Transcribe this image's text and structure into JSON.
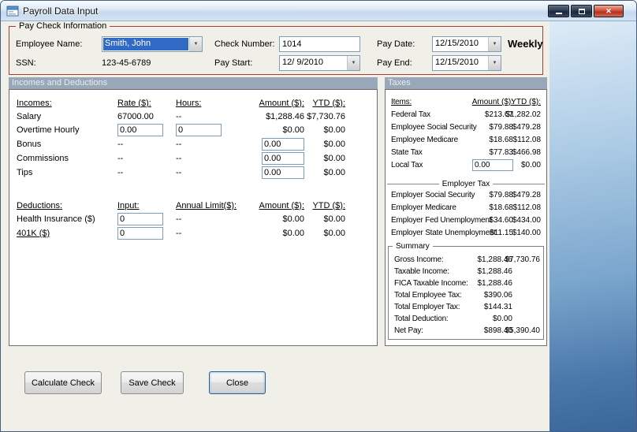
{
  "window": {
    "title": "Payroll Data Input"
  },
  "icons": {
    "dropdown_arrow": "▼",
    "close_glyph": "✕"
  },
  "colors": {
    "group_border": "#A33E35",
    "section_header_bg": "#98A8B8",
    "selection_blue": "#316AC5",
    "desktop_gradient_bottom": "#3A679B"
  },
  "pay_check_information": {
    "title": "Pay Check Information",
    "employee_name": {
      "label": "Employee Name:",
      "value": "Smith, John"
    },
    "ssn": {
      "label": "SSN:",
      "value": "123-45-6789"
    },
    "check_number": {
      "label": "Check Number:",
      "value": "1014"
    },
    "pay_start": {
      "label": "Pay Start:",
      "value": "12/ 9/2010"
    },
    "pay_date": {
      "label": "Pay Date:",
      "value": "12/15/2010"
    },
    "pay_end": {
      "label": "Pay End:",
      "value": "12/15/2010"
    },
    "frequency": "Weekly"
  },
  "incomes_and_deductions": {
    "header": "Incomes and Deductions",
    "income_headers": {
      "item": "Incomes:",
      "rate": "Rate ($):",
      "hours": "Hours:",
      "amount": "Amount ($):",
      "ytd": "YTD ($):"
    },
    "income_rows": [
      {
        "label": "Salary",
        "rate": "67000.00",
        "hours": "--",
        "amount": "$1,288.46",
        "ytd": "$7,730.76"
      },
      {
        "label": "Overtime Hourly",
        "rate_input": "0.00",
        "hours_input": "0",
        "amount": "$0.00",
        "ytd": "$0.00"
      },
      {
        "label": "Bonus",
        "rate": "--",
        "hours": "--",
        "amount_input": "0.00",
        "ytd": "$0.00"
      },
      {
        "label": "Commissions",
        "rate": "--",
        "hours": "--",
        "amount_input": "0.00",
        "ytd": "$0.00"
      },
      {
        "label": "Tips",
        "rate": "--",
        "hours": "--",
        "amount_input": "0.00",
        "ytd": "$0.00"
      }
    ],
    "deduction_headers": {
      "item": "Deductions:",
      "input": "Input:",
      "annual_limit": "Annual Limit($):",
      "amount": "Amount ($):",
      "ytd": "YTD ($):"
    },
    "deduction_rows": [
      {
        "label": "Health Insurance  ($)",
        "input": "0",
        "annual_limit": "--",
        "amount": "$0.00",
        "ytd": "$0.00"
      },
      {
        "label": "401K  ($)",
        "input": "0",
        "annual_limit": "--",
        "amount": "$0.00",
        "ytd": "$0.00"
      }
    ]
  },
  "taxes": {
    "header": "Taxes",
    "col_headers": {
      "item": "Items:",
      "amount": "Amount ($):",
      "ytd": "YTD ($):"
    },
    "employee_rows": [
      {
        "label": "Federal Tax",
        "amount": "$213.67",
        "ytd": "$1,282.02"
      },
      {
        "label": "Employee Social Security",
        "amount": "$79.88",
        "ytd": "$479.28"
      },
      {
        "label": "Employee Medicare",
        "amount": "$18.68",
        "ytd": "$112.08"
      },
      {
        "label": "State Tax",
        "amount": "$77.83",
        "ytd": "$466.98"
      },
      {
        "label": "Local Tax",
        "amount_input": "0.00",
        "ytd": "$0.00"
      }
    ],
    "employer_divider": "Employer Tax",
    "employer_rows": [
      {
        "label": "Employer Social Security",
        "amount": "$79.88",
        "ytd": "$479.28"
      },
      {
        "label": "Employer Medicare",
        "amount": "$18.68",
        "ytd": "$112.08"
      },
      {
        "label": "Employer Fed Unemployment",
        "amount": "$34.60",
        "ytd": "$434.00"
      },
      {
        "label": "Employer State Unemployment",
        "amount": "$11.15",
        "ytd": "$140.00"
      }
    ],
    "summary": {
      "title": "Summary",
      "rows": [
        {
          "label": "Gross Income:",
          "amount": "$1,288.46",
          "ytd": "$7,730.76"
        },
        {
          "label": "Taxable Income:",
          "amount": "$1,288.46",
          "ytd": ""
        },
        {
          "label": "FICA Taxable Income:",
          "amount": "$1,288.46",
          "ytd": ""
        },
        {
          "label": "Total Employee Tax:",
          "amount": "$390.06",
          "ytd": ""
        },
        {
          "label": "Total Employer Tax:",
          "amount": "$144.31",
          "ytd": ""
        },
        {
          "label": "Total Deduction:",
          "amount": "$0.00",
          "ytd": ""
        },
        {
          "label": "Net Pay:",
          "amount": "$898.40",
          "ytd": "$5,390.40"
        }
      ]
    }
  },
  "actions": {
    "calculate": "Calculate Check",
    "save": "Save Check",
    "close": "Close"
  }
}
